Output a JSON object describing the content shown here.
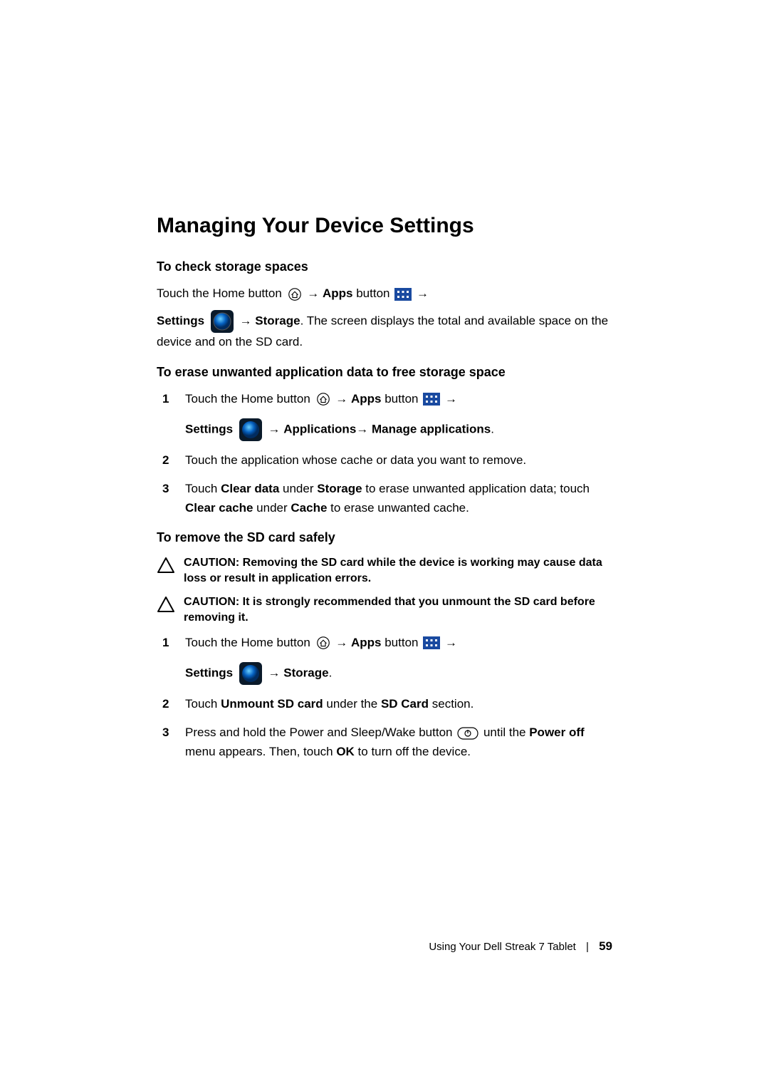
{
  "title": "Managing Your Device Settings",
  "sections": {
    "s1": {
      "heading": "To check storage spaces",
      "p1a": "Touch the Home button ",
      "p1b": " Apps",
      "p1c": " button ",
      "p2a": "Settings ",
      "p2b": " Storage",
      "p2c": ". The screen displays the total and available space on the device and on the SD card."
    },
    "s2": {
      "heading": "To erase unwanted application data to free storage space",
      "i1a": "Touch the Home button ",
      "i1b": " Apps",
      "i1c": " button ",
      "i1d": "Settings ",
      "i1e": " Applications",
      "i1f": " Manage applications",
      "i2": "Touch the application whose cache or data you want to remove.",
      "i3a": "Touch ",
      "i3b": "Clear data",
      "i3c": " under ",
      "i3d": "Storage",
      "i3e": " to erase unwanted application data; touch ",
      "i3f": "Clear cache",
      "i3g": " under ",
      "i3h": "Cache",
      "i3i": " to erase unwanted cache."
    },
    "s3": {
      "heading": "To remove the SD card safely",
      "c1a": "CAUTION: ",
      "c1b": "Removing the SD card while the device is working may cause data loss or result in application errors.",
      "c2a": "CAUTION: ",
      "c2b": "It is strongly recommended that you unmount the SD card before removing it.",
      "i1a": "Touch the Home button ",
      "i1b": " Apps",
      "i1c": " button ",
      "i1d": "Settings ",
      "i1e": " Storage",
      "i2a": "Touch ",
      "i2b": "Unmount SD card",
      "i2c": " under the ",
      "i2d": "SD Card",
      "i2e": " section.",
      "i3a": "Press and hold the Power and Sleep/Wake button ",
      "i3b": " until the ",
      "i3c": "Power off",
      "i3d": " menu appears. Then, touch ",
      "i3e": "OK",
      "i3f": " to turn off the device."
    }
  },
  "footer": {
    "label": "Using Your Dell Streak 7 Tablet",
    "page": "59"
  }
}
